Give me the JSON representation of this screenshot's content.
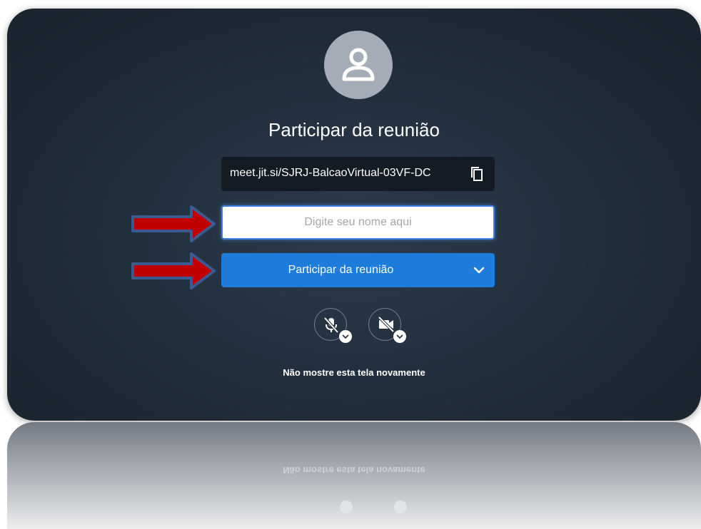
{
  "dialog": {
    "title": "Participar da reunião",
    "meeting_link": "meet.jit.si/SJRJ-BalcaoVirtual-03VF-DC",
    "name_placeholder": "Digite seu nome aqui",
    "join_label": "Participar da reunião",
    "dont_show_label": "Não mostre esta tela novamente"
  },
  "icons": {
    "avatar": "user-icon",
    "copy": "copy-icon",
    "join_options": "chevron-down-icon",
    "mic": "microphone-off-icon",
    "camera": "camera-off-icon"
  },
  "colors": {
    "panel": "#1d2935",
    "join_button": "#1e7ddb",
    "arrow": "#c00000",
    "arrow_outline": "#3b5a8f"
  }
}
